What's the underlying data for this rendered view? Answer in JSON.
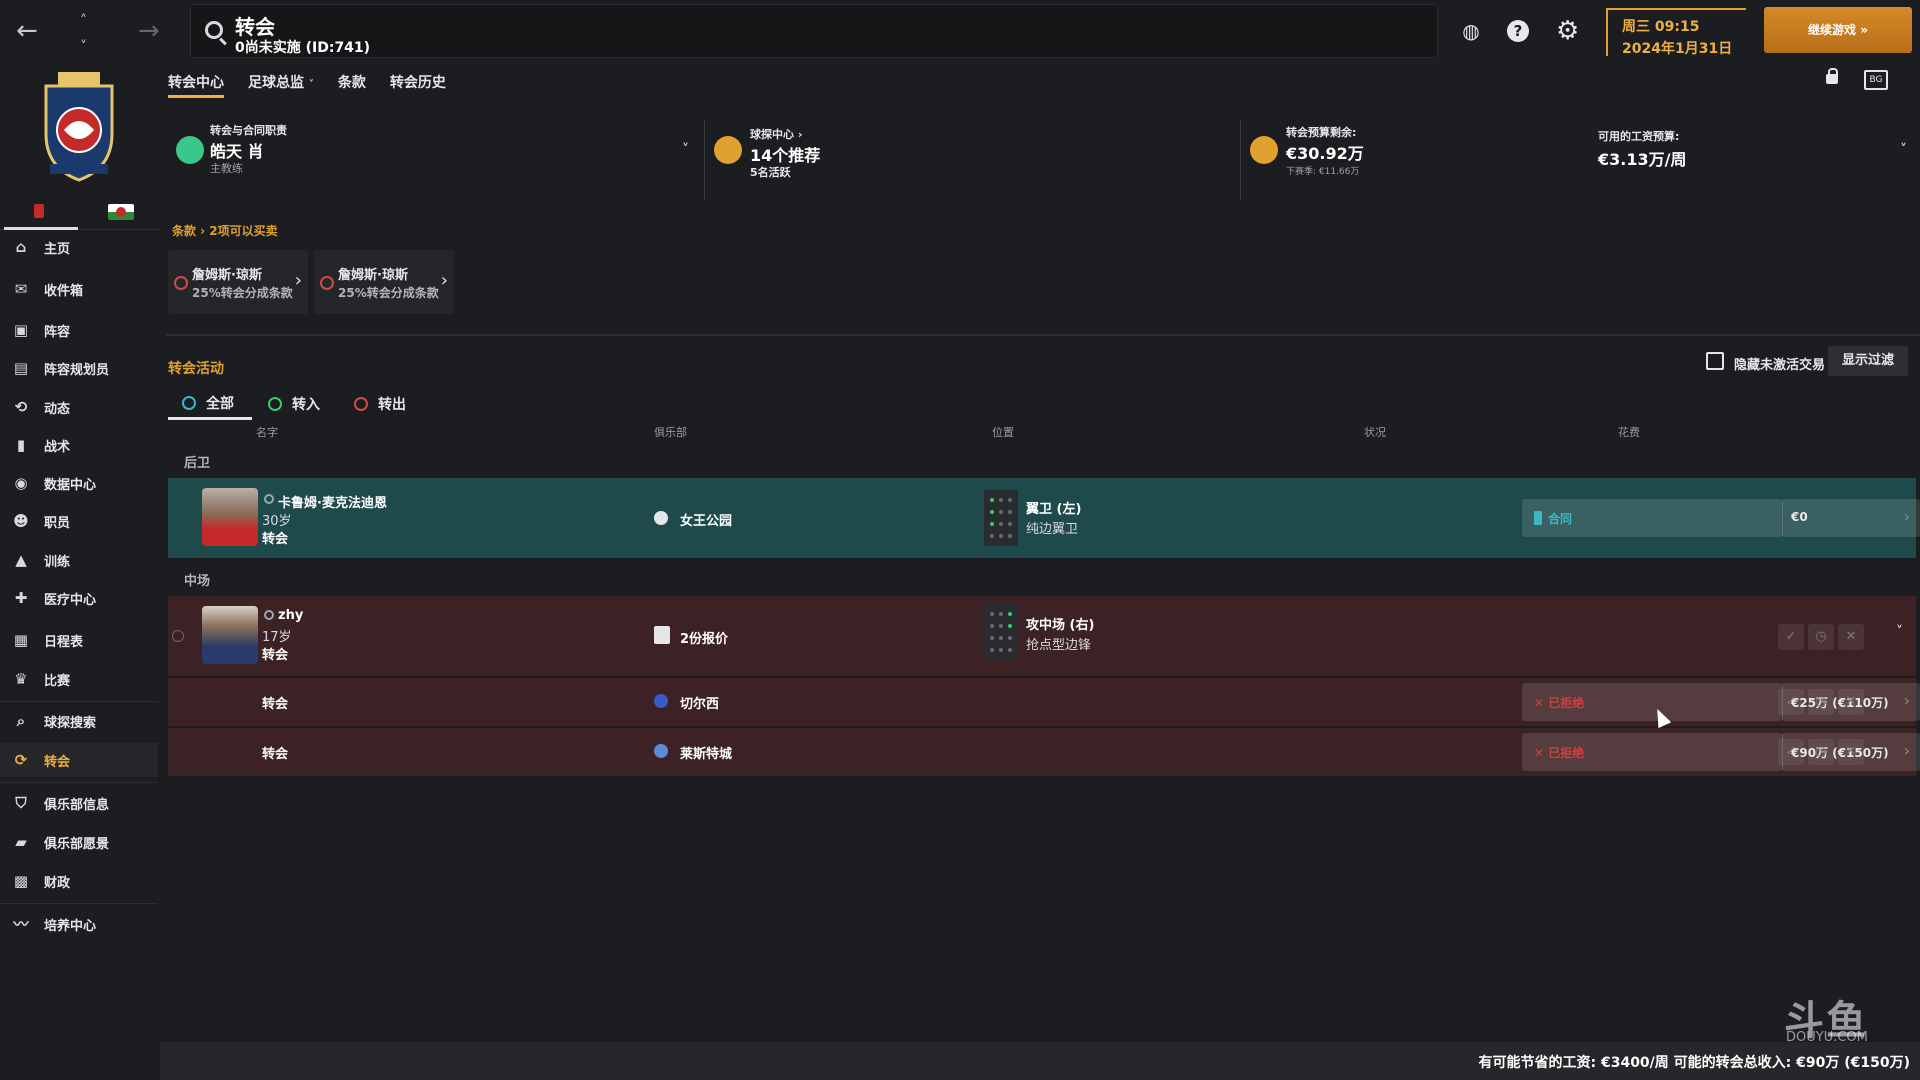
{
  "topbar": {
    "back_icon": "arrow-left-icon",
    "up_icon": "chevron-up-icon",
    "down_icon": "chevron-down-icon",
    "forward_icon": "arrow-right-icon",
    "title": "转会",
    "subtitle": "0尚未实施 (ID:741)",
    "date_line1": "周三 09:15",
    "date_line2": "2024年1月31日",
    "continue_label": "继续游戏",
    "help_glyph": "?",
    "accent": "#f0b040"
  },
  "sidebar": {
    "items": [
      {
        "label": "主页",
        "icon": "home-icon"
      },
      {
        "label": "收件箱",
        "icon": "inbox-icon"
      },
      {
        "label": "阵容",
        "icon": "shirt-icon"
      },
      {
        "label": "阵容规划员",
        "icon": "clipboard-icon"
      },
      {
        "label": "动态",
        "icon": "dynamics-icon"
      },
      {
        "label": "战术",
        "icon": "tactics-icon"
      },
      {
        "label": "数据中心",
        "icon": "data-icon"
      },
      {
        "label": "职员",
        "icon": "staff-icon"
      },
      {
        "label": "训练",
        "icon": "training-icon"
      },
      {
        "label": "医疗中心",
        "icon": "medical-icon"
      },
      {
        "label": "日程表",
        "icon": "calendar-icon"
      },
      {
        "label": "比赛",
        "icon": "trophy-icon"
      },
      {
        "label": "球探搜索",
        "icon": "scout-icon"
      },
      {
        "label": "转会",
        "icon": "transfer-icon"
      },
      {
        "label": "俱乐部信息",
        "icon": "shield-icon"
      },
      {
        "label": "俱乐部愿景",
        "icon": "vision-icon"
      },
      {
        "label": "财政",
        "icon": "finance-icon"
      },
      {
        "label": "培养中心",
        "icon": "development-icon"
      }
    ]
  },
  "main": {
    "tabs": [
      "转会中心",
      "足球总监",
      "条款",
      "转会历史"
    ],
    "info": {
      "contract_label": "转会与合同职责",
      "contract_name": "皓天 肖",
      "contract_role": "主教练",
      "scout_label": "球探中心 ›",
      "scout_count": "14个推荐",
      "scout_active": "5名活跃",
      "budget_label": "转会预算剩余:",
      "budget_value": "€30.92万",
      "budget_next": "下赛季: €11.66万",
      "wage_label": "可用的工资预算:",
      "wage_value": "€3.13万/周"
    },
    "breadcrumb": "条款  ›  2项可以买卖",
    "clauses": [
      {
        "name": "詹姆斯·琼斯",
        "desc": "25%转会分成条款"
      },
      {
        "name": "詹姆斯·琼斯",
        "desc": "25%转会分成条款"
      }
    ],
    "activity_title": "转会活动",
    "hide_inactive": "隐藏未激活交易",
    "show_filter": "显示过滤",
    "activity_tabs": [
      "全部",
      "转入",
      "转出"
    ],
    "columns": {
      "name": "名字",
      "club": "俱乐部",
      "position": "位置",
      "status": "状况",
      "fee": "花费"
    },
    "groups": {
      "defenders": "后卫",
      "midfield": "中场"
    },
    "rows": [
      {
        "name": "卡鲁姆·麦克法迪恩",
        "age": "30岁",
        "type": "转会",
        "club": "女王公园",
        "pos_main": "翼卫 (左)",
        "pos_sub": "纯边翼卫",
        "status": "合同",
        "fee": "€0",
        "status_color": "#3ab8c8"
      },
      {
        "name": "zhy",
        "age": "17岁",
        "type": "转会",
        "club": "2份报价",
        "pos_main": "攻中场 (右)",
        "pos_sub": "抢点型边锋"
      },
      {
        "type": "转会",
        "club": "切尔西",
        "status": "已拒绝",
        "fee": "€25万 (€110万)",
        "status_color": "#d04040"
      },
      {
        "type": "转会",
        "club": "莱斯特城",
        "status": "已拒绝",
        "fee": "€90万 (€150万)",
        "status_color": "#d04040"
      }
    ]
  },
  "footer": {
    "text": "有可能节省的工资: €3400/周 可能的转会总收入: €90万 (€150万)"
  },
  "watermark": {
    "main": "斗鱼",
    "sub": "DOUYU.COM"
  }
}
